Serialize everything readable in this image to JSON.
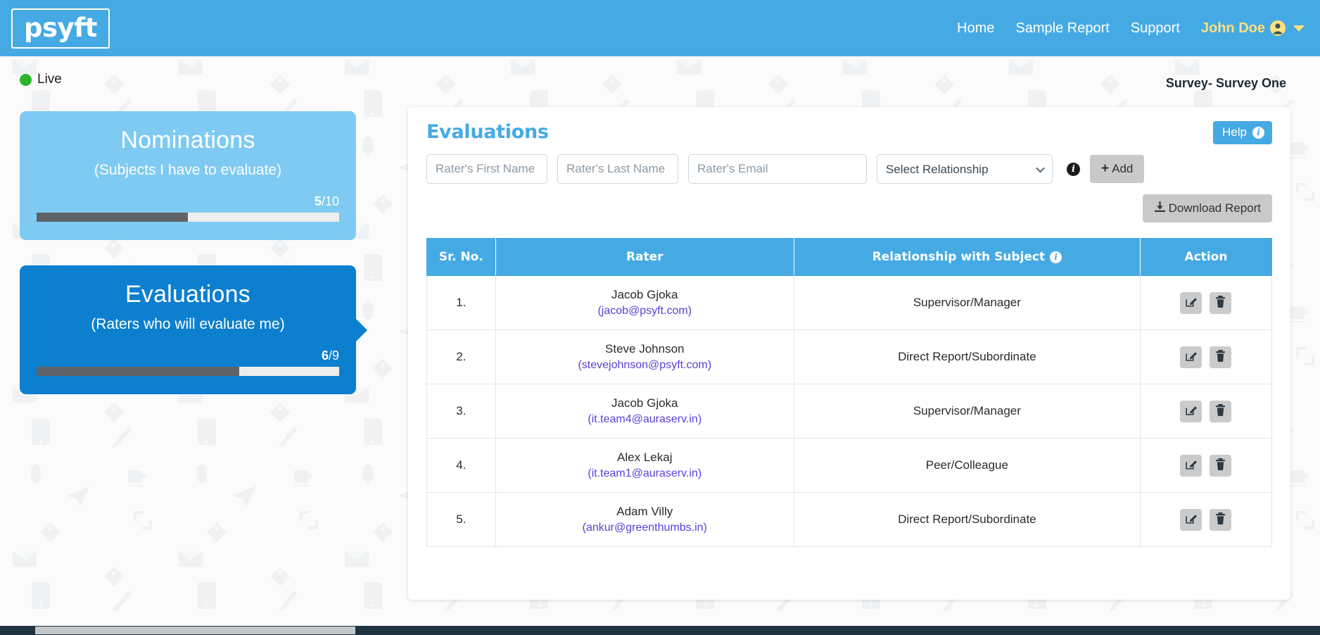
{
  "navbar": {
    "logo_text": "psyft",
    "links": [
      {
        "label": "Home"
      },
      {
        "label": "Sample Report"
      },
      {
        "label": "Support"
      }
    ],
    "user_name": "John Doe"
  },
  "status": {
    "live_label": "Live",
    "live_color": "#2cb42c"
  },
  "survey": {
    "label": "Survey- Survey One"
  },
  "cards": [
    {
      "title": "Nominations",
      "subtitle": "(Subjects I have to evaluate)",
      "current": "5",
      "separator": "/",
      "total": "10",
      "progress_percent": 50,
      "color": "#7ecaf2"
    },
    {
      "title": "Evaluations",
      "subtitle": "(Raters who will evaluate me)",
      "current": "6",
      "separator": "/",
      "total": "9",
      "progress_percent": 67,
      "color": "#0c7fce"
    }
  ],
  "panel": {
    "title": "Evaluations",
    "help_label": "Help",
    "form": {
      "first_name_placeholder": "Rater's First Name",
      "first_name_value": "",
      "last_name_placeholder": "Rater's Last Name",
      "last_name_value": "",
      "email_placeholder": "Rater's Email",
      "email_value": "",
      "relationship_selected": "Select Relationship",
      "relationship_options": [
        "Select Relationship",
        "Supervisor/Manager",
        "Direct Report/Subordinate",
        "Peer/Colleague"
      ],
      "add_label": "Add",
      "add_glyph": "+"
    },
    "download_label": "Download Report",
    "table": {
      "headers": {
        "sr": "Sr. No.",
        "rater": "Rater",
        "relationship": "Relationship with Subject",
        "action": "Action"
      },
      "rows": [
        {
          "sr": "1.",
          "name": "Jacob Gjoka",
          "email": "(jacob@psyft.com)",
          "relationship": "Supervisor/Manager"
        },
        {
          "sr": "2.",
          "name": "Steve Johnson",
          "email": "(stevejohnson@psyft.com)",
          "relationship": "Direct Report/Subordinate"
        },
        {
          "sr": "3.",
          "name": "Jacob Gjoka",
          "email": "(it.team4@auraserv.in)",
          "relationship": "Supervisor/Manager"
        },
        {
          "sr": "4.",
          "name": "Alex Lekaj",
          "email": "(it.team1@auraserv.in)",
          "relationship": "Peer/Colleague"
        },
        {
          "sr": "5.",
          "name": "Adam Villy",
          "email": "(ankur@greenthumbs.in)",
          "relationship": "Direct Report/Subordinate"
        }
      ]
    }
  },
  "colors": {
    "brand_blue": "#45aae4",
    "card_dark_blue": "#0c7fce",
    "card_light_blue": "#7ecaf2",
    "accent_yellow": "#fcdf7e",
    "link_purple": "#5a3fd6",
    "progress_fill": "#5f6368"
  }
}
